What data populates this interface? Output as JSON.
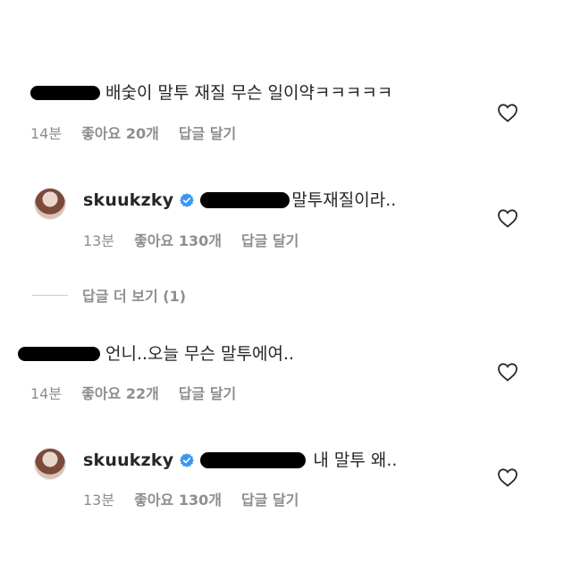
{
  "comments": [
    {
      "text": "배숯이 말투 재질 무슨 일이약ㅋㅋㅋㅋㅋ",
      "time": "14분",
      "likes": "좋아요 20개",
      "reply": "답글 달기"
    },
    {
      "username": "skuukzky",
      "text": "말투재질이라..",
      "time": "13분",
      "likes": "좋아요 130개",
      "reply": "답글 달기"
    },
    {
      "text": "언니..오늘 무슨 말투에여..",
      "time": "14분",
      "likes": "좋아요 22개",
      "reply": "답글 달기"
    },
    {
      "username": "skuukzky",
      "text": "내 말투 왜..",
      "time": "13분",
      "likes": "좋아요 130개",
      "reply": "답글 달기"
    }
  ],
  "more_replies": "답글 더 보기 (1)",
  "colors": {
    "text": "#262626",
    "meta": "#8e8e8e",
    "verified": "#3897f0"
  },
  "icons": {
    "like": "heart-outline-icon",
    "verified": "verified-badge-icon"
  }
}
